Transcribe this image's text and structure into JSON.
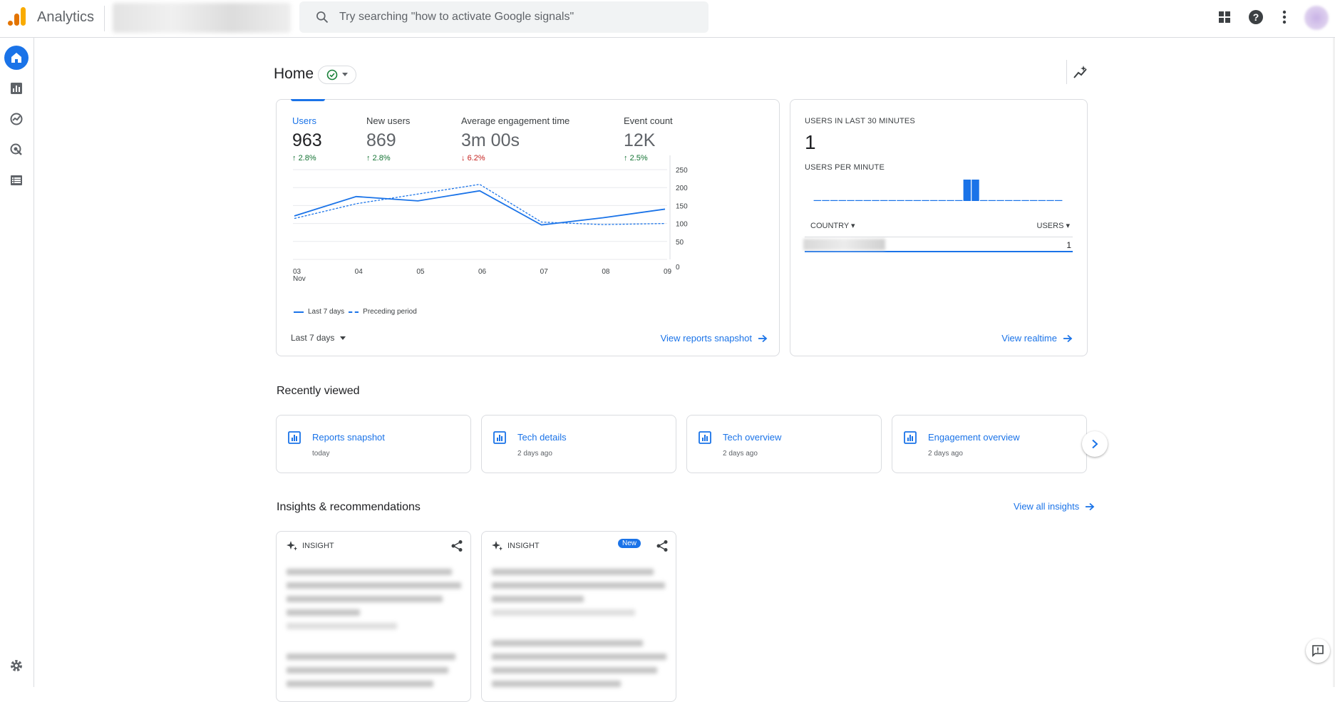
{
  "header": {
    "app_name": "Analytics",
    "search_placeholder": "Try searching \"how to activate Google signals\"",
    "icons": [
      "apps-grid-icon",
      "help-icon",
      "more-vert-icon"
    ]
  },
  "leftnav": {
    "items": [
      "home-icon",
      "reports-icon",
      "explore-icon",
      "advertising-icon",
      "configure-icon"
    ],
    "settings": "settings-gear-icon"
  },
  "home": {
    "title": "Home"
  },
  "summary": {
    "metrics": [
      {
        "label": "Users",
        "value": "963",
        "delta": "2.8%",
        "direction": "up"
      },
      {
        "label": "New users",
        "value": "869",
        "delta": "2.8%",
        "direction": "up"
      },
      {
        "label": "Average engagement time",
        "value": "3m 00s",
        "delta": "6.2%",
        "direction": "down"
      },
      {
        "label": "Event count",
        "value": "12K",
        "delta": "2.5%",
        "direction": "up"
      }
    ],
    "legend_current": "Last 7 days",
    "legend_previous": "Preceding period",
    "range_label": "Last 7 days",
    "view_link": "View reports snapshot"
  },
  "chart_data": {
    "type": "line",
    "x": [
      "03",
      "04",
      "05",
      "06",
      "07",
      "08",
      "09"
    ],
    "x_sublabel": "Nov",
    "y_ticks": [
      0,
      50,
      100,
      150,
      200,
      250
    ],
    "ylim": [
      0,
      250
    ],
    "series": [
      {
        "name": "Last 7 days",
        "style": "solid",
        "values": [
          121,
          175,
          163,
          191,
          96,
          116,
          140
        ]
      },
      {
        "name": "Preceding period",
        "style": "dashed",
        "values": [
          114,
          155,
          182,
          209,
          104,
          97,
          100
        ]
      }
    ],
    "grid": true,
    "color": "#1a73e8"
  },
  "realtime": {
    "caption": "USERS IN LAST 30 MINUTES",
    "value": "1",
    "per_minute_caption": "USERS PER MINUTE",
    "per_minute": [
      0,
      0,
      0,
      0,
      0,
      0,
      0,
      0,
      0,
      0,
      0,
      0,
      0,
      0,
      0,
      0,
      0,
      0,
      1,
      1,
      0,
      0,
      0,
      0,
      0,
      0,
      0,
      0,
      0,
      0
    ],
    "col_country": "COUNTRY",
    "col_users": "USERS",
    "row_value": "1",
    "view_link": "View realtime"
  },
  "recently_viewed": {
    "title": "Recently viewed",
    "items": [
      {
        "name": "Reports snapshot",
        "time": "today"
      },
      {
        "name": "Tech details",
        "time": "2 days ago"
      },
      {
        "name": "Tech overview",
        "time": "2 days ago"
      },
      {
        "name": "Engagement overview",
        "time": "2 days ago"
      }
    ]
  },
  "insights": {
    "title": "Insights & recommendations",
    "view_all": "View all insights",
    "cards": [
      {
        "label": "INSIGHT",
        "badge": ""
      },
      {
        "label": "INSIGHT",
        "badge": "New"
      }
    ]
  }
}
